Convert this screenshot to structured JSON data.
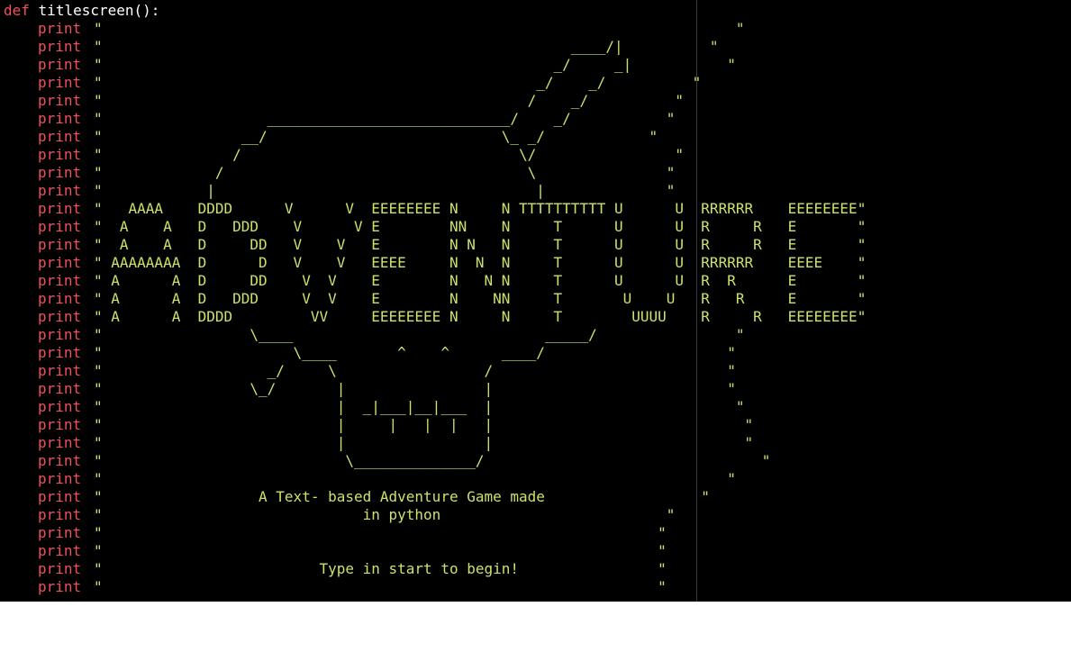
{
  "colors": {
    "background": "#000000",
    "keyword": "#f0505a",
    "string": "#cfe06a",
    "identifier": "#ffffff"
  },
  "code": {
    "header": {
      "keyword": "def",
      "name": "titlescreen():"
    },
    "print_keyword": "print",
    "lines": [
      "\"                                                                         \"",
      "\"                                                      ____/|          \" ",
      "\"                                                    _/     _|           \"",
      "\"                                                  _/    _/          \"",
      "\"                                                 /    _/          \"",
      "\"                   ____________________________/    _/           \"",
      "\"                __/                           \\_ _/            \"",
      "\"               /                                \\/                \"",
      "\"             /                                   \\               \"",
      "\"            |                                     |              \"",
      "\"   AAAA    DDDD      V      V  EEEEEEEE N     N TTTTTTTTTT U      U  RRRRRR    EEEEEEEE\"",
      "\"  A    A   D   DDD    V      V E        NN    N     T      U      U  R     R   E       \"",
      "\"  A    A   D     DD   V    V   E        N N   N     T      U      U  R     R   E       \"",
      "\" AAAAAAAA  D      D   V    V   EEEE     N  N  N     T      U      U  RRRRRR    EEEE    \"",
      "\" A      A  D     DD    V  V    E        N   N N     T      U      U  R  R      E       \"",
      "\" A      A  D   DDD     V  V    E        N    NN     T       U    U   R   R     E       \"",
      "\" A      A  DDDD         VV     EEEEEEEE N     N     T        UUUU    R     R   EEEEEEEE\"",
      "\"                 \\____                             _____/                \"",
      "\"                      \\____       ^    ^      ____/                     \"",
      "\"                   _/     \\                 /                           \"",
      "\"                 \\_/       |                |                           \"",
      "\"                           |  _|___|__|___  |                            \"",
      "\"                           |     |   |  |   |                             \"",
      "\"                           |                |                             \"",
      "\"                            \\______________/                                \"",
      "\"                                                                        \"",
      "\"                  A Text- based Adventure Game made                  \"",
      "\"                              in python                          \"",
      "\"                                                                \"",
      "\"                                                                \"",
      "\"                         Type in start to begin!                \"",
      "\"                                                                \""
    ]
  }
}
